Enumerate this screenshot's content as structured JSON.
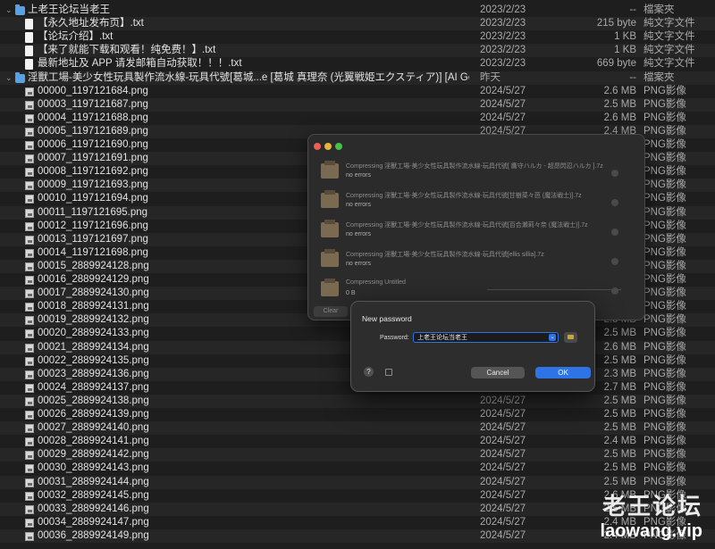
{
  "rows": [
    {
      "disc": "⌄",
      "icon": "folder",
      "indent": 0,
      "name": "上老王论坛当老王",
      "date": "2023/2/23",
      "size": "--",
      "kind": "檔案夾"
    },
    {
      "icon": "doc",
      "indent": 1,
      "name": "【永久地址发布页】.txt",
      "date": "2023/2/23",
      "size": "215 byte",
      "kind": "純文字文件"
    },
    {
      "icon": "doc",
      "indent": 1,
      "name": "【论坛介绍】.txt",
      "date": "2023/2/23",
      "size": "1 KB",
      "kind": "純文字文件"
    },
    {
      "icon": "doc",
      "indent": 1,
      "name": "【来了就能下载和观看！纯免费！】.txt",
      "date": "2023/2/23",
      "size": "1 KB",
      "kind": "純文字文件"
    },
    {
      "icon": "doc",
      "indent": 1,
      "name": "最新地址及 APP 请发邮箱自动获取！！！.txt",
      "date": "2023/2/23",
      "size": "669 byte",
      "kind": "純文字文件"
    },
    {
      "disc": "⌄",
      "icon": "folder",
      "indent": 0,
      "name": "淫獸工場-美少女性玩具製作流水線-玩具代號[葛城...e [葛城 真理奈 (光翼戦姫エクスティア)] [AI Generat",
      "date": "昨天",
      "size": "--",
      "kind": "檔案夾"
    },
    {
      "icon": "img",
      "indent": 1,
      "name": "00000_1197121684.png",
      "date": "2024/5/27",
      "size": "2.6 MB",
      "kind": "PNG影像"
    },
    {
      "icon": "img",
      "indent": 1,
      "name": "00003_1197121687.png",
      "date": "2024/5/27",
      "size": "2.5 MB",
      "kind": "PNG影像"
    },
    {
      "icon": "img",
      "indent": 1,
      "name": "00004_1197121688.png",
      "date": "2024/5/27",
      "size": "2.6 MB",
      "kind": "PNG影像"
    },
    {
      "icon": "img",
      "indent": 1,
      "name": "00005_1197121689.png",
      "date": "2024/5/27",
      "size": "2.4 MB",
      "kind": "PNG影像"
    },
    {
      "icon": "img",
      "indent": 1,
      "name": "00006_1197121690.png",
      "date": "",
      "size": "",
      "kind": "PNG影像"
    },
    {
      "icon": "img",
      "indent": 1,
      "name": "00007_1197121691.png",
      "date": "",
      "size": "",
      "kind": "PNG影像"
    },
    {
      "icon": "img",
      "indent": 1,
      "name": "00008_1197121692.png",
      "date": "",
      "size": "",
      "kind": "PNG影像"
    },
    {
      "icon": "img",
      "indent": 1,
      "name": "00009_1197121693.png",
      "date": "",
      "size": "",
      "kind": "PNG影像"
    },
    {
      "icon": "img",
      "indent": 1,
      "name": "00010_1197121694.png",
      "date": "",
      "size": "",
      "kind": "PNG影像"
    },
    {
      "icon": "img",
      "indent": 1,
      "name": "00011_1197121695.png",
      "date": "",
      "size": "",
      "kind": "PNG影像"
    },
    {
      "icon": "img",
      "indent": 1,
      "name": "00012_1197121696.png",
      "date": "",
      "size": "",
      "kind": "PNG影像"
    },
    {
      "icon": "img",
      "indent": 1,
      "name": "00013_1197121697.png",
      "date": "",
      "size": "",
      "kind": "PNG影像"
    },
    {
      "icon": "img",
      "indent": 1,
      "name": "00014_1197121698.png",
      "date": "",
      "size": "",
      "kind": "PNG影像"
    },
    {
      "icon": "img",
      "indent": 1,
      "name": "00015_2889924128.png",
      "date": "",
      "size": "",
      "kind": "PNG影像"
    },
    {
      "icon": "img",
      "indent": 1,
      "name": "00016_2889924129.png",
      "date": "",
      "size": "",
      "kind": "PNG影像"
    },
    {
      "icon": "img",
      "indent": 1,
      "name": "00017_2889924130.png",
      "date": "",
      "size": "",
      "kind": "PNG影像"
    },
    {
      "icon": "img",
      "indent": 1,
      "name": "00018_2889924131.png",
      "date": "",
      "size": "",
      "kind": "PNG影像"
    },
    {
      "icon": "img",
      "indent": 1,
      "name": "00019_2889924132.png",
      "date": "",
      "size": "2.5 MB",
      "kind": "PNG影像"
    },
    {
      "icon": "img",
      "indent": 1,
      "name": "00020_2889924133.png",
      "date": "",
      "size": "2.5 MB",
      "kind": "PNG影像"
    },
    {
      "icon": "img",
      "indent": 1,
      "name": "00021_2889924134.png",
      "date": "",
      "size": "2.6 MB",
      "kind": "PNG影像"
    },
    {
      "icon": "img",
      "indent": 1,
      "name": "00022_2889924135.png",
      "date": "",
      "size": "2.5 MB",
      "kind": "PNG影像"
    },
    {
      "icon": "img",
      "indent": 1,
      "name": "00023_2889924136.png",
      "date": "",
      "size": "2.3 MB",
      "kind": "PNG影像"
    },
    {
      "icon": "img",
      "indent": 1,
      "name": "00024_2889924137.png",
      "date": "",
      "size": "2.7 MB",
      "kind": "PNG影像"
    },
    {
      "icon": "img",
      "indent": 1,
      "name": "00025_2889924138.png",
      "date": "2024/5/27",
      "size": "2.5 MB",
      "kind": "PNG影像"
    },
    {
      "icon": "img",
      "indent": 1,
      "name": "00026_2889924139.png",
      "date": "2024/5/27",
      "size": "2.5 MB",
      "kind": "PNG影像"
    },
    {
      "icon": "img",
      "indent": 1,
      "name": "00027_2889924140.png",
      "date": "2024/5/27",
      "size": "2.5 MB",
      "kind": "PNG影像"
    },
    {
      "icon": "img",
      "indent": 1,
      "name": "00028_2889924141.png",
      "date": "2024/5/27",
      "size": "2.4 MB",
      "kind": "PNG影像"
    },
    {
      "icon": "img",
      "indent": 1,
      "name": "00029_2889924142.png",
      "date": "2024/5/27",
      "size": "2.5 MB",
      "kind": "PNG影像"
    },
    {
      "icon": "img",
      "indent": 1,
      "name": "00030_2889924143.png",
      "date": "2024/5/27",
      "size": "2.5 MB",
      "kind": "PNG影像"
    },
    {
      "icon": "img",
      "indent": 1,
      "name": "00031_2889924144.png",
      "date": "2024/5/27",
      "size": "2.5 MB",
      "kind": "PNG影像"
    },
    {
      "icon": "img",
      "indent": 1,
      "name": "00032_2889924145.png",
      "date": "2024/5/27",
      "size": "2.6 MB",
      "kind": "PNG影像"
    },
    {
      "icon": "img",
      "indent": 1,
      "name": "00033_2889924146.png",
      "date": "2024/5/27",
      "size": "2.5 MB",
      "kind": "PNG影像"
    },
    {
      "icon": "img",
      "indent": 1,
      "name": "00034_2889924147.png",
      "date": "2024/5/27",
      "size": "2.4 MB",
      "kind": "PNG影像"
    },
    {
      "icon": "img",
      "indent": 1,
      "name": "00036_2889924149.png",
      "date": "2024/5/27",
      "size": "2.4 MB",
      "kind": "PNG影像"
    }
  ],
  "progress_window": {
    "clear_label": "Clear",
    "jobs": [
      {
        "title": "Compressing 淫獸工場-美少女性玩具製作流水線-玩具代號[ 鷹守ハルカ - 超昂閃忍ハルカ ].7z",
        "status": "no errors"
      },
      {
        "title": "Compressing 淫獸工場-美少女性玩具製作流水線-玩具代號[甘樹菜々芭 (魔法戦士)].7z",
        "status": "no errors"
      },
      {
        "title": "Compressing 淫獸工場-美少女性玩具製作流水線-玩具代號[百合瀬莉々奈 (魔法戦士)].7z",
        "status": "no errors"
      },
      {
        "title": "Compressing 淫獸工場-美少女性玩具製作流水線-玩具代號[ellis sillia].7z",
        "status": "no errors"
      },
      {
        "title": "Compressing Untitled",
        "status": "0 B"
      }
    ]
  },
  "password_dialog": {
    "title": "New password",
    "label": "Password:",
    "value": "上老王论坛当老王",
    "help": "?",
    "cancel": "Cancel",
    "ok": "OK"
  },
  "watermark": {
    "line1": "老王论坛",
    "line2": "laowang.vip"
  },
  "colors": {
    "accent": "#2f74e6",
    "folder": "#5aa1e3",
    "background": "#1e1e1e"
  }
}
